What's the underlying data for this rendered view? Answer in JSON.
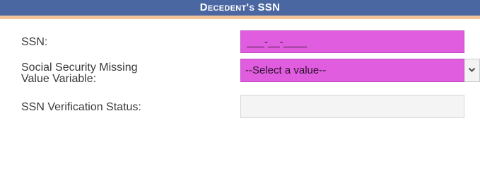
{
  "section": {
    "title": "Decedent's SSN"
  },
  "fields": {
    "ssn": {
      "label": "SSN:",
      "value": "___-__-____"
    },
    "missing_value_variable": {
      "label_line1": "Social Security Missing",
      "label_line2": "Value Variable:",
      "selected": "--Select a value--"
    },
    "verification_status": {
      "label": "SSN Verification Status:",
      "value": ""
    }
  },
  "icons": {
    "select_arrow": "chevron-down-icon"
  },
  "colors": {
    "header_bg": "#4b67a2",
    "header_accent": "#f2c29a",
    "required_field_bg": "#e05de0",
    "readonly_field_bg": "#f4f4f4"
  }
}
